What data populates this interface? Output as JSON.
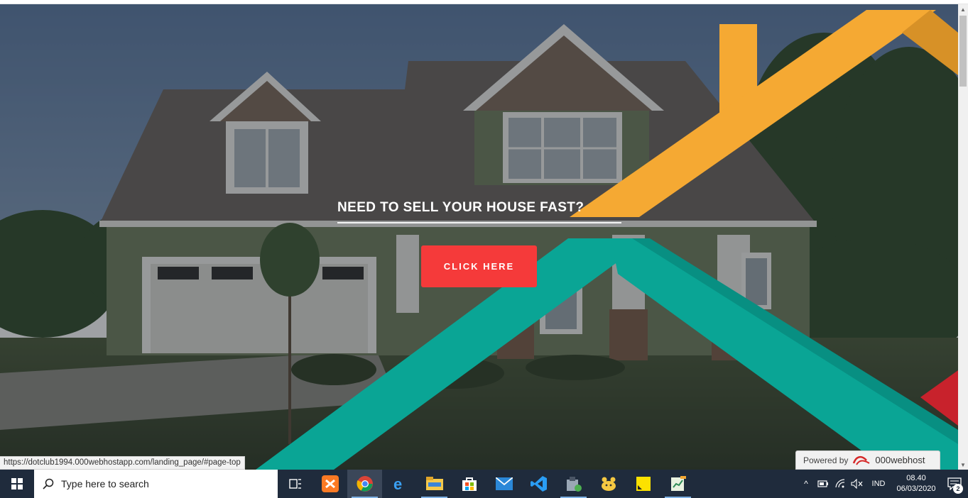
{
  "hero": {
    "headline": "NEED TO SELL YOUR HOUSE FAST?",
    "cta_label": "CLICK HERE"
  },
  "powered": {
    "label": "Powered by",
    "brand": "000webhost"
  },
  "status_bar": {
    "url": "https://dotclub1994.000webhostapp.com/landing_page/#page-top"
  },
  "taskbar": {
    "search_placeholder": "Type here to search",
    "apps": [
      "task-view",
      "xampp",
      "chrome",
      "edge",
      "file-explorer",
      "store",
      "mail",
      "vscode",
      "app-launcher",
      "app-yellow",
      "sticky-notes",
      "notepad-chart"
    ],
    "active_app": "chrome",
    "language": "IND",
    "time": "08.40",
    "date": "06/03/2020",
    "notification_count": "2"
  },
  "colors": {
    "orange_stripe": "#f5a933",
    "teal_stripe": "#0aa595",
    "cta": "#f53a3a",
    "red_triangle": "#c8222c",
    "taskbar": "#1f2b3c"
  }
}
